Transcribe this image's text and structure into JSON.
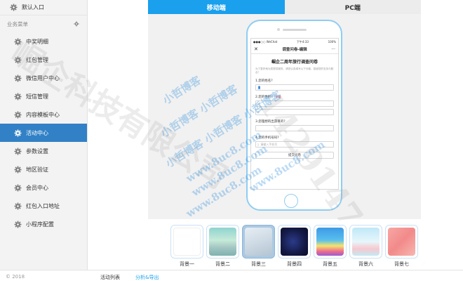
{
  "sidebar": {
    "top_label": "默认入口",
    "section_label": "业务菜单",
    "items": [
      {
        "label": "中奖明细",
        "active": false
      },
      {
        "label": "红包管理",
        "active": false
      },
      {
        "label": "微信用户中心",
        "active": false
      },
      {
        "label": "短信管理",
        "active": false
      },
      {
        "label": "内容模板中心",
        "active": false
      },
      {
        "label": "活动中心",
        "active": true
      },
      {
        "label": "参数设置",
        "active": false
      },
      {
        "label": "地区验证",
        "active": false
      },
      {
        "label": "会员中心",
        "active": false
      },
      {
        "label": "红包入口地址",
        "active": false
      },
      {
        "label": "小程序配置",
        "active": false
      }
    ]
  },
  "tabs": {
    "mobile": "移动端",
    "pc": "PC端"
  },
  "phone": {
    "status_signal": "●●●○○ WeChat",
    "status_time": "下午4:33",
    "status_battery": "100%",
    "nav_title": "调查问卷-编辑",
    "survey_title": "崛企二周年旅行调查问卷",
    "survey_desc": "为了更好地为您提供服务，请您认真填写以下问卷，感谢您的支持与配合！",
    "q1_label": "1.您的姓名?",
    "q2_label": "2.您的性别?",
    "q2_required": "*必填",
    "q3_label": "3.您理想的出游目的?",
    "q4_label": "4.您的手机号码?",
    "q4_placeholder": "请输入手机号",
    "submit_label": "提交问卷"
  },
  "backgrounds": [
    {
      "label": "背景一",
      "selected": false
    },
    {
      "label": "背景二",
      "selected": false
    },
    {
      "label": "背景三",
      "selected": true
    },
    {
      "label": "背景四",
      "selected": false
    },
    {
      "label": "背景五",
      "selected": false
    },
    {
      "label": "背景六",
      "selected": false
    },
    {
      "label": "背景七",
      "selected": false
    }
  ],
  "bottom": {
    "left_label": "© 2018",
    "tab_list": "活动列表",
    "tab_share": "分析&导出"
  },
  "watermarks": {
    "big": "崛企科技有限公司",
    "number": "1429147",
    "blue_lines": [
      "小哲博客",
      "小哲博客 小哲博客",
      "小哲博客 小哲博客 小哲博客",
      "www.8uc8.com",
      "www.8uc8.com",
      "www.8uc8.com",
      "www.8uc8.com"
    ]
  },
  "colors": {
    "accent": "#1aa0ec",
    "sidebar_active": "#3281c6",
    "phone_border": "#8fcdf2"
  }
}
